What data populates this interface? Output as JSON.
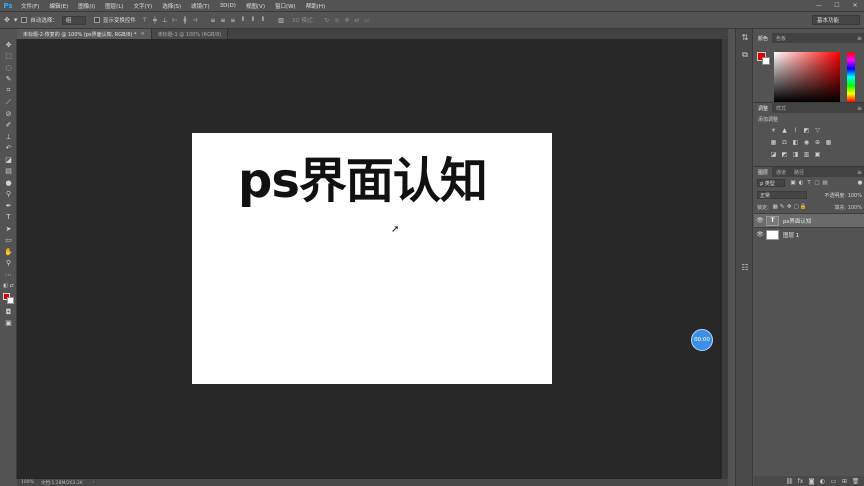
{
  "app": {
    "logo": "Ps"
  },
  "menu": [
    "文件(F)",
    "编辑(E)",
    "图像(I)",
    "图层(L)",
    "文字(Y)",
    "选择(S)",
    "滤镜(T)",
    "3D(D)",
    "视图(V)",
    "窗口(W)",
    "帮助(H)"
  ],
  "window_controls": {
    "minimize": "—",
    "maximize": "☐",
    "close": "✕"
  },
  "options": {
    "auto_select_label": "自动选择：",
    "auto_select_value": "组",
    "show_transform_label": "显示变换控件",
    "mode_3d_label": "3D 模式：",
    "workspace": "基本功能"
  },
  "tabs": [
    {
      "label": "未标题-2-恢复的 @ 100% (ps界面认知, RGB/8) *",
      "close": "×",
      "active": true
    },
    {
      "label": "未标题-1 @ 100% (RGB/8)",
      "close": "",
      "active": false
    }
  ],
  "document": {
    "title_text": "ps界面认知",
    "background": "#ffffff"
  },
  "timer_bubble": "00:00",
  "status": {
    "zoom": "100%",
    "doc_info": "文档:1.28M/263.2K"
  },
  "color_panel": {
    "tabs": [
      "颜色",
      "色板"
    ],
    "foreground": "#e00000",
    "background": "#ffffff"
  },
  "adjust_panel": {
    "tabs": [
      "调整",
      "样式"
    ],
    "add_label": "添加调整"
  },
  "layers_panel": {
    "tabs": [
      "图层",
      "通道",
      "路径"
    ],
    "filter_kind": "ρ 类型",
    "blend_mode": "正常",
    "opacity_label": "不透明度: 100%",
    "lock_label": "锁定:",
    "fill_label": "填充: 100%",
    "layers": [
      {
        "name": "ps界面认知",
        "type": "text",
        "thumb": "T",
        "selected": true
      },
      {
        "name": "图层 1",
        "type": "pixel",
        "thumb": "",
        "selected": false
      }
    ]
  },
  "colors": {
    "accent_blue": "#31a8ff",
    "canvas_bg": "#282828",
    "ui_bg": "#535353",
    "timer_blue": "#3b8fe6"
  }
}
